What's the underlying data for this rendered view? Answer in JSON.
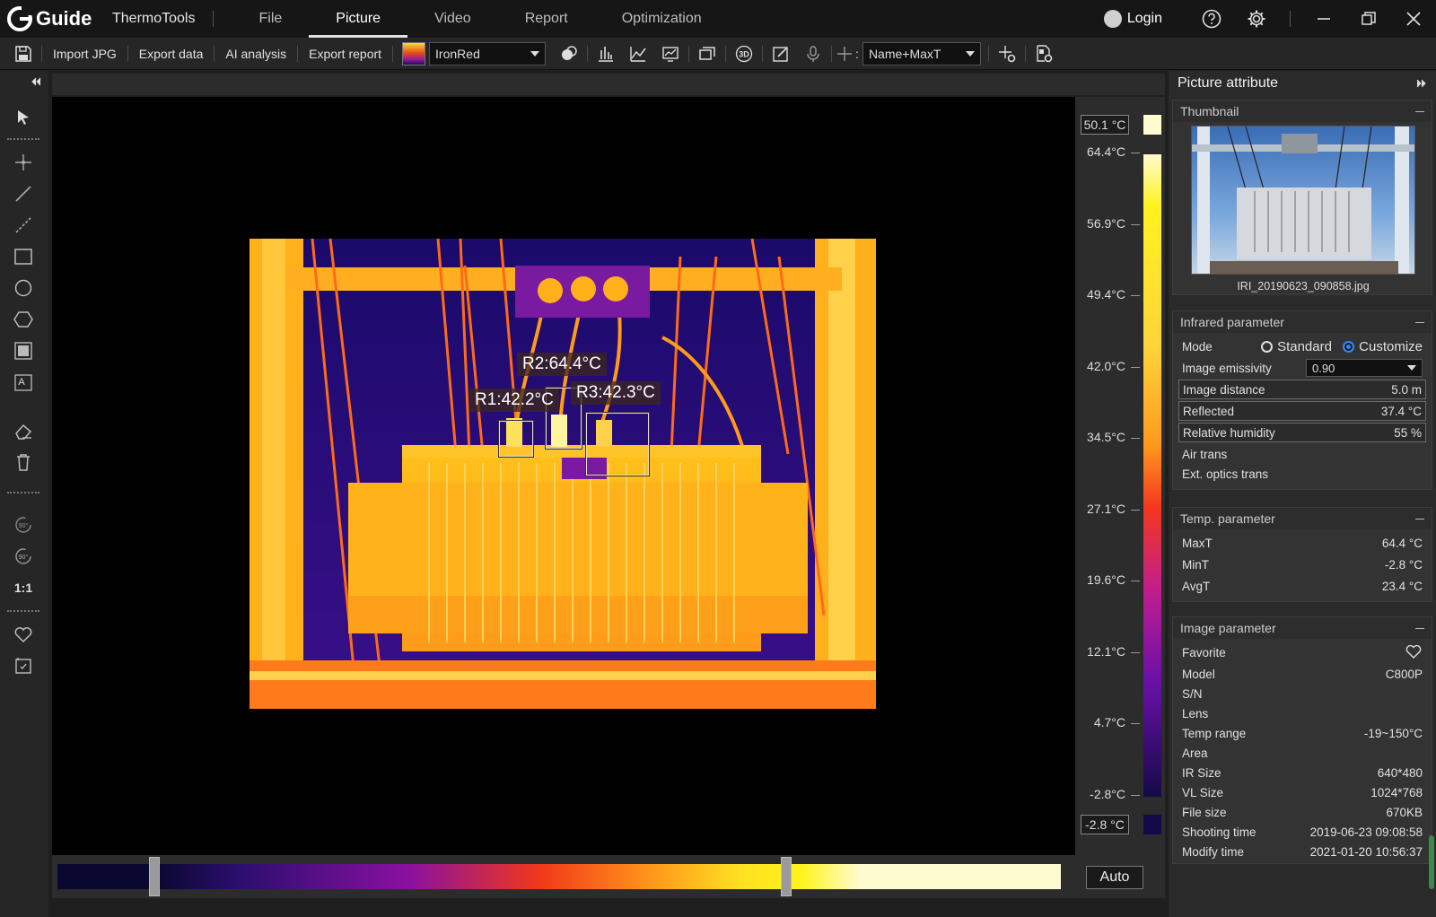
{
  "titlebar": {
    "logo_text": "Guide",
    "app_name": "ThermoTools",
    "tabs": [
      {
        "label": "File"
      },
      {
        "label": "Picture"
      },
      {
        "label": "Video"
      },
      {
        "label": "Report"
      },
      {
        "label": "Optimization"
      }
    ],
    "login_label": "Login"
  },
  "toolbar": {
    "import_label": "Import JPG",
    "export_data_label": "Export data",
    "ai_label": "AI analysis",
    "export_report_label": "Export report",
    "palette_value": "IronRed",
    "label_mode_value": "Name+MaxT"
  },
  "leftstrip": {
    "ratio_label": "1:1"
  },
  "image": {
    "regions": [
      {
        "label": "R1:42.2°C"
      },
      {
        "label": "R2:64.4°C"
      },
      {
        "label": "R3:42.3°C"
      }
    ]
  },
  "scale": {
    "top_box": "50.1 °C",
    "bottom_box": "-2.8 °C",
    "ticks": [
      "64.4°C",
      "56.9°C",
      "49.4°C",
      "42.0°C",
      "34.5°C",
      "27.1°C",
      "19.6°C",
      "12.1°C",
      "4.7°C",
      "-2.8°C"
    ]
  },
  "range": {
    "auto_label": "Auto"
  },
  "panel": {
    "title": "Picture attribute",
    "thumbnail": {
      "title": "Thumbnail",
      "filename": "IRI_20190623_090858.jpg"
    },
    "infrared": {
      "title": "Infrared parameter",
      "mode_label": "Mode",
      "mode_standard": "Standard",
      "mode_customize": "Customize",
      "emissivity_label": "Image emissivity",
      "emissivity_value": "0.90",
      "distance_label": "Image distance",
      "distance_value": "5.0 m",
      "reflected_label": "Reflected",
      "reflected_value": "37.4 °C",
      "humidity_label": "Relative humidity",
      "humidity_value": "55 %",
      "air_trans_label": "Air trans",
      "ext_optics_label": "Ext. optics trans"
    },
    "temp": {
      "title": "Temp. parameter",
      "rows": [
        {
          "label": "MaxT",
          "value": "64.4 °C"
        },
        {
          "label": "MinT",
          "value": "-2.8 °C"
        },
        {
          "label": "AvgT",
          "value": "23.4 °C"
        }
      ]
    },
    "image_param": {
      "title": "Image parameter",
      "favorite_label": "Favorite",
      "rows": [
        {
          "label": "Model",
          "value": "C800P"
        },
        {
          "label": "S/N",
          "value": ""
        },
        {
          "label": "Lens",
          "value": ""
        },
        {
          "label": "Temp range",
          "value": "-19~150°C"
        },
        {
          "label": "Area",
          "value": ""
        },
        {
          "label": "IR Size",
          "value": "640*480"
        },
        {
          "label": "VL Size",
          "value": "1024*768"
        },
        {
          "label": "File size",
          "value": "670KB"
        },
        {
          "label": "Shooting time",
          "value": "2019-06-23 09:08:58"
        },
        {
          "label": "Modify time",
          "value": "2021-01-20 10:56:37"
        }
      ]
    }
  }
}
